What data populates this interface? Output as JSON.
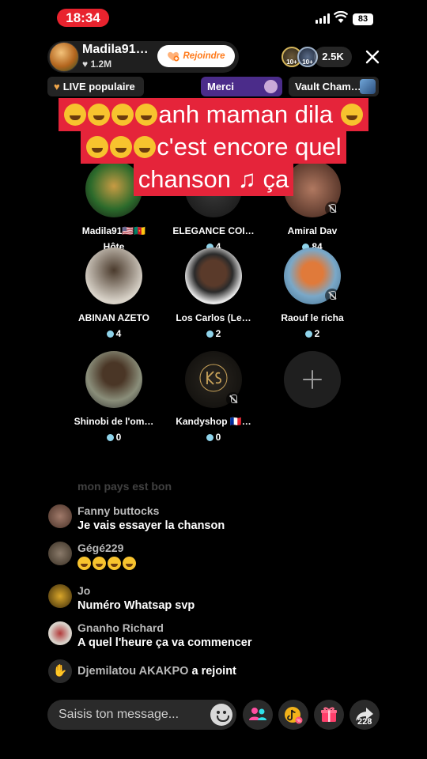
{
  "status_bar": {
    "time": "18:34",
    "battery": "83"
  },
  "host": {
    "name": "Madila91…",
    "likes": "1.2M",
    "join_label": "Rejoindre"
  },
  "viewers": {
    "badge1": "10+",
    "badge2": "10+",
    "count": "2.5K"
  },
  "chips": {
    "live": "LIVE populaire",
    "merci": "Merci",
    "vault": "Vault Cham…"
  },
  "caption": {
    "line1": "anh maman dila",
    "line2": "c'est encore quel",
    "line3": "chanson",
    "line3_end": "ça"
  },
  "seats": [
    {
      "name": "Madila91🇺🇸🇨🇲",
      "sub": "Hôte"
    },
    {
      "name": "ELEGANCE COI…",
      "count": "4"
    },
    {
      "name": "Amiral Dav",
      "count": "84"
    },
    {
      "name": "ABINAN AZETO",
      "count": "4"
    },
    {
      "name": "Los Carlos (Le…",
      "count": "2"
    },
    {
      "name": "Raouf le richa",
      "count": "2"
    },
    {
      "name": "Shinobi de l'om…",
      "count": "0"
    },
    {
      "name": "Kandyshop 🇫🇷…",
      "count": "0"
    }
  ],
  "chat": {
    "faded": "mon pays est bon",
    "messages": [
      {
        "user": "Fanny buttocks",
        "text": "Je vais essayer la chanson"
      },
      {
        "user": "Gégé229",
        "text": ""
      },
      {
        "user": "Jo",
        "text": "Numéro Whatsap svp"
      },
      {
        "user": "Gnanho Richard",
        "text": "A quel l'heure ça va commencer"
      }
    ],
    "joined": {
      "user": "Djemilatou AKAKPO",
      "action": "a rejoint"
    }
  },
  "bottom": {
    "input_placeholder": "Saisis ton message...",
    "share_count": "228"
  },
  "colors": {
    "accent_red": "#e5243a",
    "merci_purple": "#4b2c8a",
    "join_orange": "#ff7a1a"
  }
}
